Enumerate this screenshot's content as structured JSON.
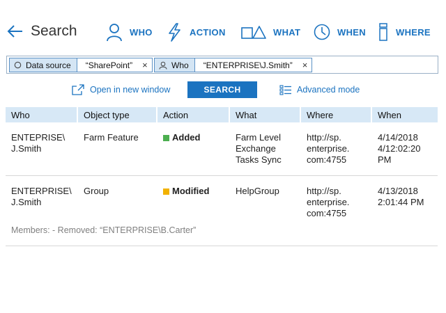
{
  "header": {
    "title": "Search",
    "nav": [
      {
        "label": "WHO",
        "icon": "person-icon"
      },
      {
        "label": "ACTION",
        "icon": "lightning-icon"
      },
      {
        "label": "WHAT",
        "icon": "objects-icon"
      },
      {
        "label": "WHEN",
        "icon": "clock-icon"
      },
      {
        "label": "WHERE",
        "icon": "server-icon"
      }
    ]
  },
  "filters": [
    {
      "key": "Data source",
      "icon": "circle-icon",
      "value": "“SharePoint”",
      "remove": "×"
    },
    {
      "key": "Who",
      "icon": "person-icon",
      "value": "“ENTERPRISE\\J.Smith”",
      "remove": "×"
    }
  ],
  "actions": {
    "open_new_window": "Open in new window",
    "search": "SEARCH",
    "advanced_mode": "Advanced mode"
  },
  "table": {
    "columns": [
      "Who",
      "Object type",
      "Action",
      "What",
      "Where",
      "When"
    ],
    "rows": [
      {
        "who": "ENTEPRISE\\ J.Smith",
        "object_type": "Farm Feature",
        "action": "Added",
        "action_color": "#4caf50",
        "what": "Farm Level Exchange Tasks Sync",
        "where": "http://sp. enterprise. com:4755",
        "when": "4/14/2018 4/12:02:20 PM"
      },
      {
        "who": "ENTERPRISE\\ J.Smith",
        "object_type": "Group",
        "action": "Modified",
        "action_color": "#f2b200",
        "what": "HelpGroup",
        "where": "http://sp. enterprise. com:4755",
        "when": "4/13/2018 2:01:44 PM",
        "detail": "Members: - Removed: “ENTERPRISE\\B.Carter”"
      }
    ]
  },
  "colors": {
    "accent": "#1b73c0",
    "header_bg": "#d7e8f6",
    "chip_bg": "#d4e5f4"
  }
}
